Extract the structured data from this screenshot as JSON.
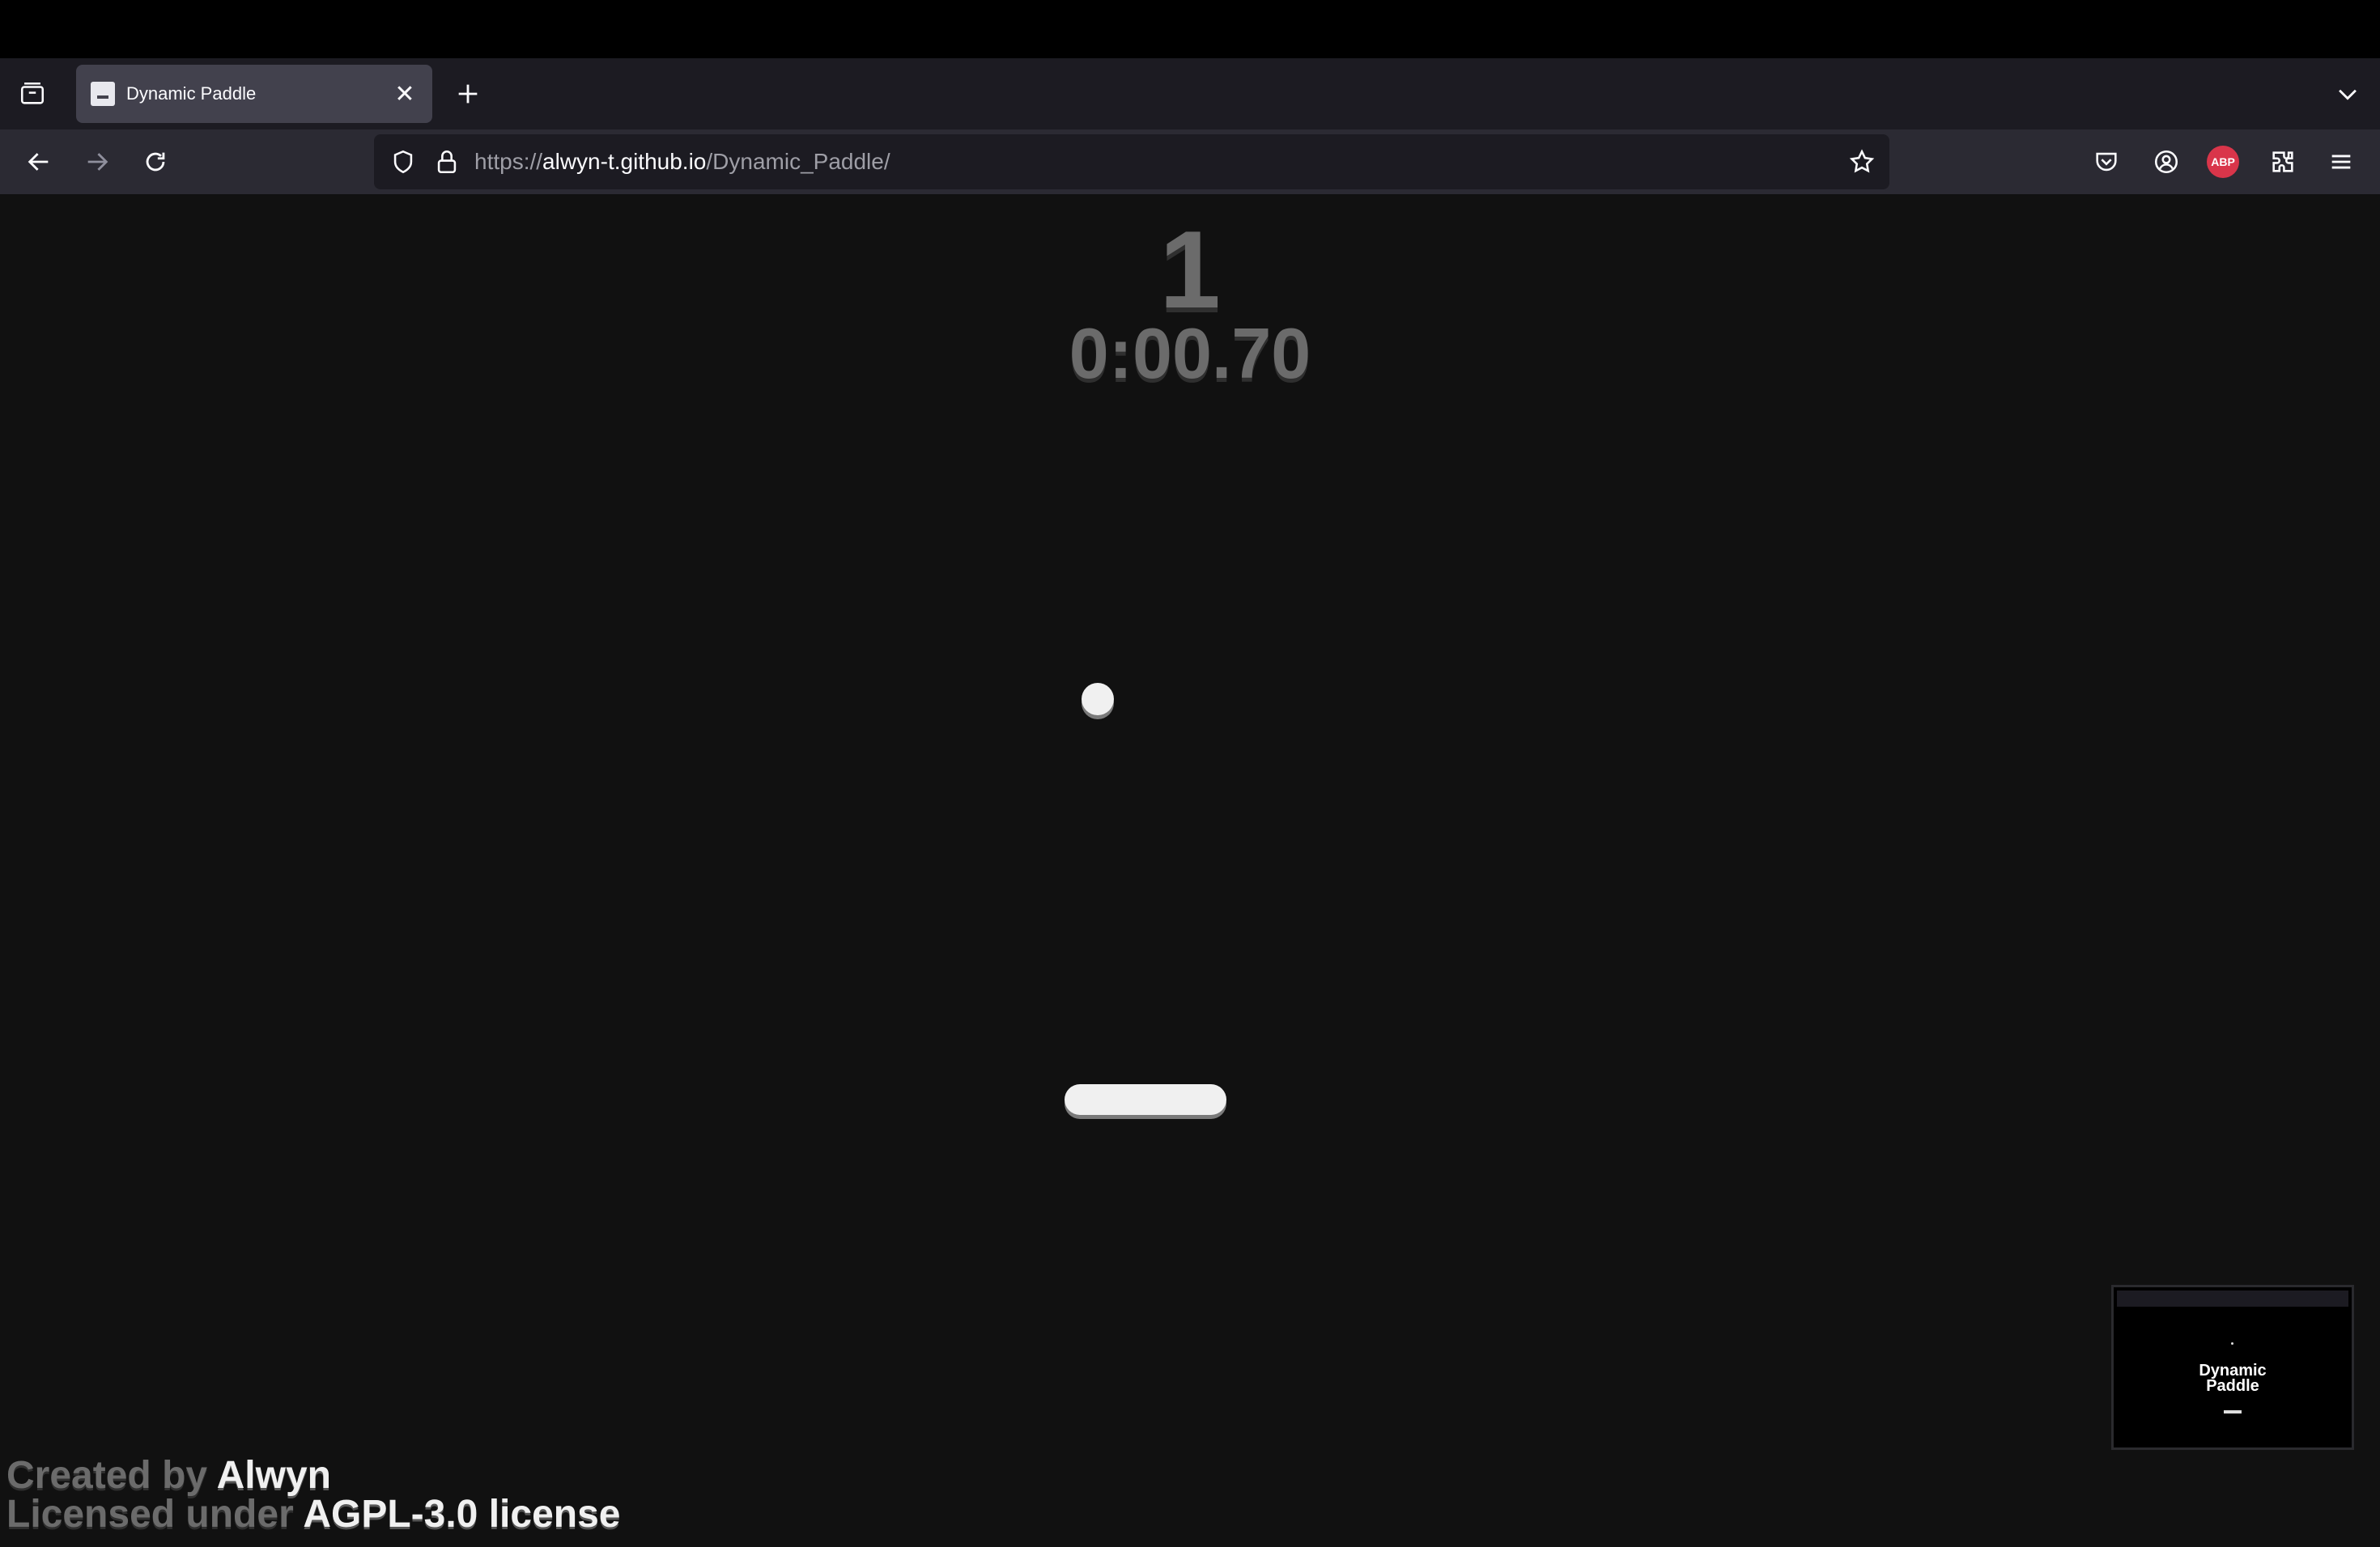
{
  "browser": {
    "tab": {
      "title": "Dynamic Paddle"
    },
    "url": {
      "scheme": "https://",
      "host": "alwyn-t.github.io",
      "path": "/Dynamic_Paddle/"
    },
    "extension_badge": "ABP"
  },
  "game": {
    "score": "1",
    "timer": "0:00.70"
  },
  "credits": {
    "created_prefix": "Created by ",
    "author": "Alwyn",
    "license_prefix": "Licensed under ",
    "license": "AGPL-3.0 license"
  },
  "thumbnail": {
    "title_line1": "Dynamic",
    "title_line2": "Paddle"
  },
  "colors": {
    "page_bg": "#111111",
    "score_text": "#6b6b6b",
    "ball": "#f0f0f0",
    "paddle": "#f0f0f0",
    "abp_badge": "#d9354a"
  }
}
